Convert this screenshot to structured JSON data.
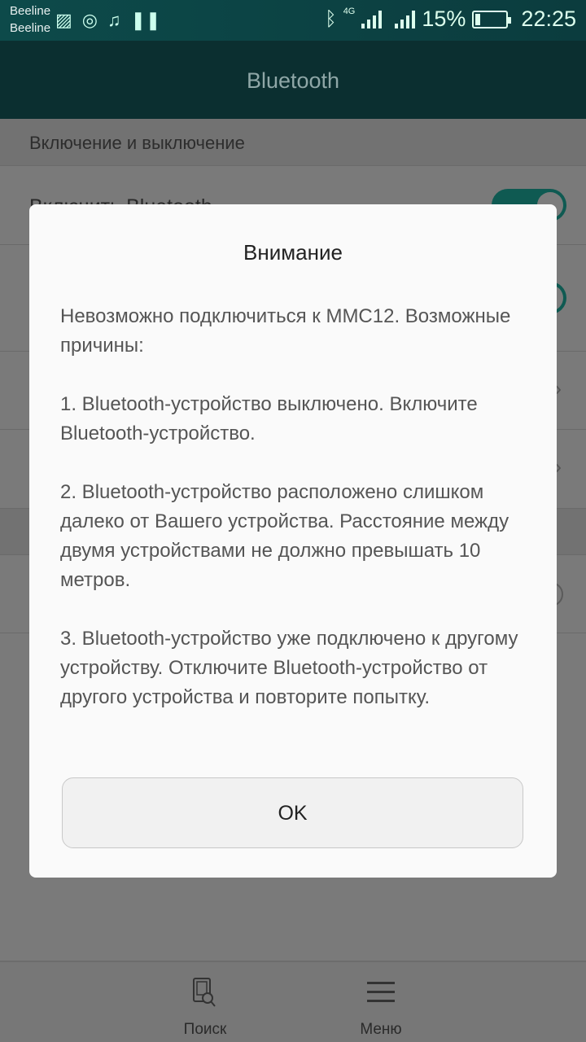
{
  "status_bar": {
    "carriers": [
      "Beeline",
      "Beeline"
    ],
    "icons": [
      "gallery-icon",
      "instagram-icon",
      "music-icon",
      "pause-icon"
    ],
    "network": "4G",
    "battery": "15%",
    "battery_level": 15,
    "time": "22:25"
  },
  "header": {
    "title": "Bluetooth"
  },
  "settings": {
    "section": "Включение и выключение",
    "row1": "Включить Bluetooth",
    "toggles_on": true
  },
  "dialog": {
    "title": "Внимание",
    "paragraphs": [
      "Невозможно подключиться к MMC12. Возможные причины:",
      "1. Bluetooth-устройство выключено. Включите Bluetooth-устройство.",
      "2. Bluetooth-устройство расположено слишком далеко от Вашего устройства. Расстояние между двумя устройствами не должно превышать 10 метров.",
      "3. Bluetooth-устройство уже подключено к другому устройству. Отключите Bluetooth-устройство от другого устройства и повторите попытку."
    ],
    "ok": "OK"
  },
  "bottom_bar": {
    "search": "Поиск",
    "menu": "Меню"
  },
  "colors": {
    "accent": "#0f5a52",
    "header": "#0b2f30"
  }
}
